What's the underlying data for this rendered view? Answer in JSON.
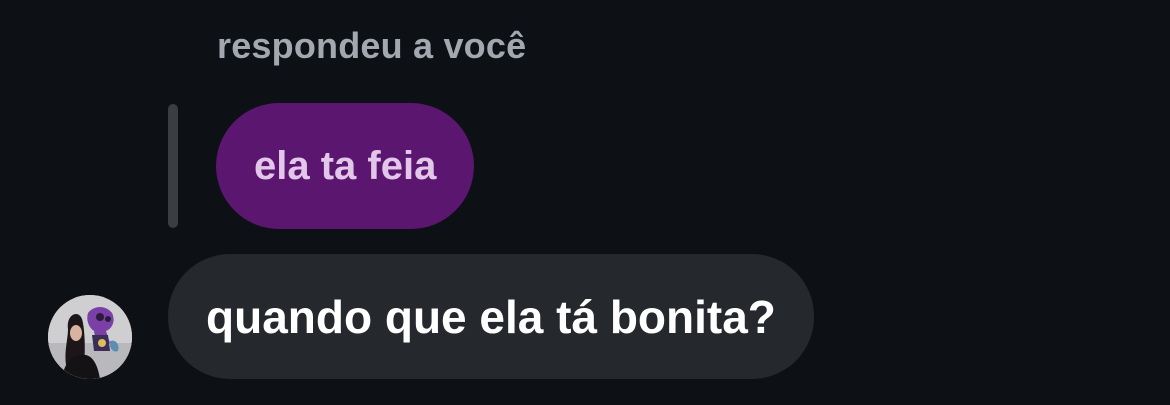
{
  "reply": {
    "header": "respondeu a você",
    "quoted_text": "ela ta feia"
  },
  "message": {
    "text": "quando que ela tá bonita?",
    "avatar_icon": "user-avatar"
  },
  "colors": {
    "background": "#0d1014",
    "quoted_bubble": "#5b1670",
    "message_bubble": "#25282d",
    "header_text": "#a3a7b0"
  }
}
